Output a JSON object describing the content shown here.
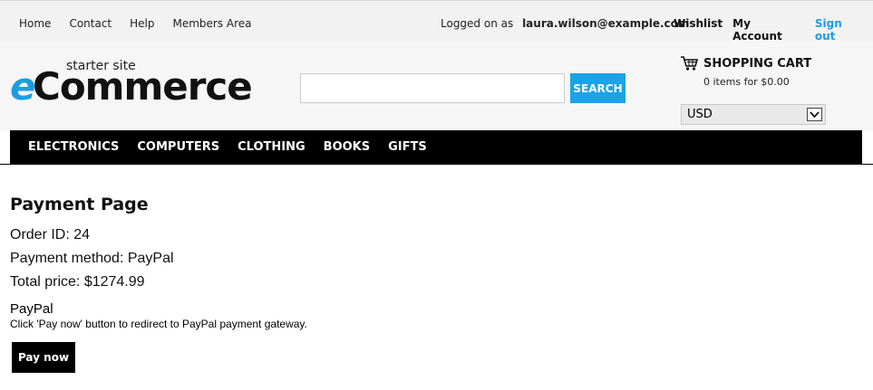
{
  "topnav": {
    "items": [
      "Home",
      "Contact",
      "Help",
      "Members Area"
    ]
  },
  "session": {
    "logged_label": "Logged on as",
    "email": "laura.wilson@example.com"
  },
  "account": {
    "wishlist": "Wishlist",
    "my_account": "My Account",
    "sign_out": "Sign out"
  },
  "logo": {
    "starter": "starter site",
    "e": "e",
    "commerce": "Commerce"
  },
  "search": {
    "value": "",
    "placeholder": "",
    "button": "SEARCH"
  },
  "cart": {
    "title": "SHOPPING CART",
    "summary": "0 items for $0.00",
    "icon": "cart-icon"
  },
  "currency": {
    "selected": "USD"
  },
  "categories": [
    "ELECTRONICS",
    "COMPUTERS",
    "CLOTHING",
    "BOOKS",
    "GIFTS"
  ],
  "payment": {
    "title": "Payment Page",
    "order_id": "Order ID: 24",
    "method": "Payment method: PayPal",
    "total": "Total price: $1274.99",
    "gateway_name": "PayPal",
    "gateway_desc": "Click 'Pay now' button to redirect to PayPal payment gateway.",
    "pay_button": "Pay now"
  },
  "colors": {
    "accent": "#1aa3e8",
    "nav_bg": "#000000",
    "topbar_bg": "#f2f2f2"
  }
}
